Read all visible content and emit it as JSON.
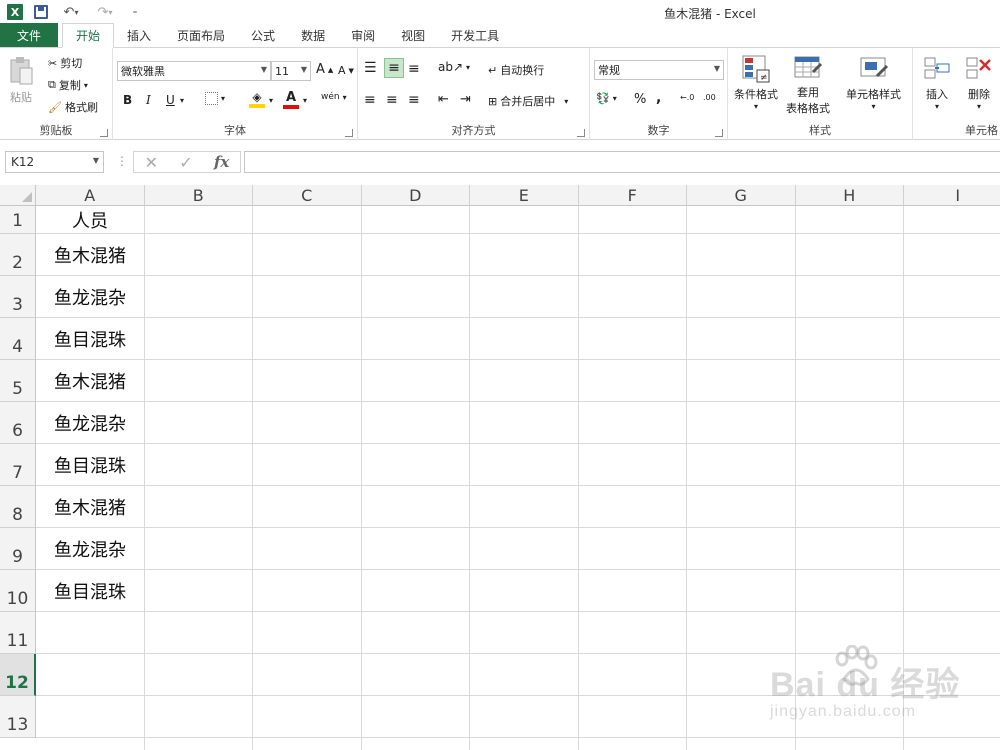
{
  "window": {
    "title": "鱼木混猪 - Excel"
  },
  "tabs": [
    "文件",
    "开始",
    "插入",
    "页面布局",
    "公式",
    "数据",
    "审阅",
    "视图",
    "开发工具"
  ],
  "ribbon": {
    "clipboard": {
      "paste": "粘贴",
      "cut": "剪切",
      "copy": "复制",
      "format_painter": "格式刷",
      "label": "剪贴板"
    },
    "font": {
      "name": "微软雅黑",
      "size": "11",
      "bold": "B",
      "italic": "I",
      "underline": "U",
      "grow": "A",
      "shrink": "A",
      "label": "字体",
      "font_color_glyph": "A",
      "phonetic": "wén"
    },
    "alignment": {
      "wrap": "自动换行",
      "merge": "合并后居中",
      "label": "对齐方式"
    },
    "number": {
      "format": "常规",
      "percent": "%",
      "comma": ",",
      "label": "数字"
    },
    "styles": {
      "cond": "条件格式",
      "table1": "套用",
      "table2": "表格格式",
      "cell": "单元格样式",
      "label": "样式"
    },
    "cells": {
      "insert": "插入",
      "delete": "删除",
      "label": "单元格"
    }
  },
  "formula_bar": {
    "name_box": "K12",
    "fx": "fx",
    "cancel": "✕",
    "enter": "✓",
    "value": ""
  },
  "sheet": {
    "columns": [
      "A",
      "B",
      "C",
      "D",
      "E",
      "F",
      "G",
      "H",
      "I"
    ],
    "rows": [
      "1",
      "2",
      "3",
      "4",
      "5",
      "6",
      "7",
      "8",
      "9",
      "10",
      "11",
      "12",
      "13"
    ],
    "selected_row": "12",
    "column_a": [
      "人员",
      "鱼木混猪",
      "鱼龙混杂",
      "鱼目混珠",
      "鱼木混猪",
      "鱼龙混杂",
      "鱼目混珠",
      "鱼木混猪",
      "鱼龙混杂",
      "鱼目混珠"
    ]
  },
  "watermark": {
    "main": "Bai du 经验",
    "sub": "jingyan.baidu.com"
  },
  "colors": {
    "excel_green": "#217346",
    "highlight": "#ffd400",
    "font_red": "#e01010"
  }
}
